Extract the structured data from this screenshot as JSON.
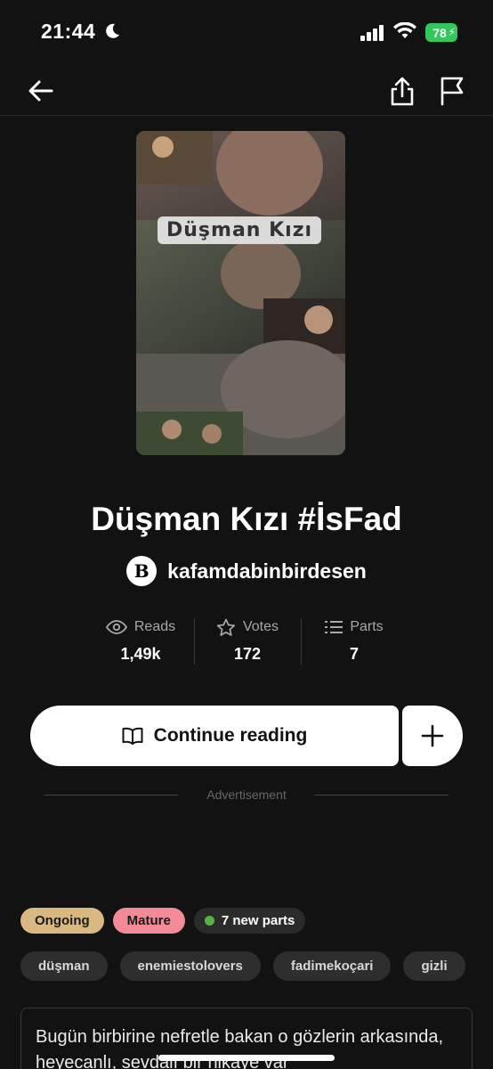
{
  "status_bar": {
    "time": "21:44",
    "battery": "78"
  },
  "nav": {
    "back_icon": "arrow-left-icon",
    "share_icon": "share-icon",
    "report_icon": "flag-icon"
  },
  "cover": {
    "title_text": "Düşman Kızı"
  },
  "story": {
    "title": "Düşman Kızı #İsFad",
    "author": "kafamdabinbirdesen",
    "author_avatar_letter": "B"
  },
  "stats": [
    {
      "label": "Reads",
      "value": "1,49k",
      "icon": "eye-icon"
    },
    {
      "label": "Votes",
      "value": "172",
      "icon": "star-icon"
    },
    {
      "label": "Parts",
      "value": "7",
      "icon": "list-icon"
    }
  ],
  "actions": {
    "continue_label": "Continue reading"
  },
  "advertisement_label": "Advertisement",
  "badges": {
    "status": "Ongoing",
    "rating": "Mature",
    "new_parts": "7 new parts"
  },
  "tags": [
    "düşman",
    "enemiestolovers",
    "fadimekoçari",
    "gizli"
  ],
  "description": "Bugün birbirine nefretle bakan o gözlerin arkasında, heyecanlı, sevdalı bir hikaye var",
  "colors": {
    "background": "#121212",
    "ongoing": "#d9b981",
    "mature": "#f28b96",
    "new_dot": "#56b33f",
    "battery": "#34c759"
  }
}
